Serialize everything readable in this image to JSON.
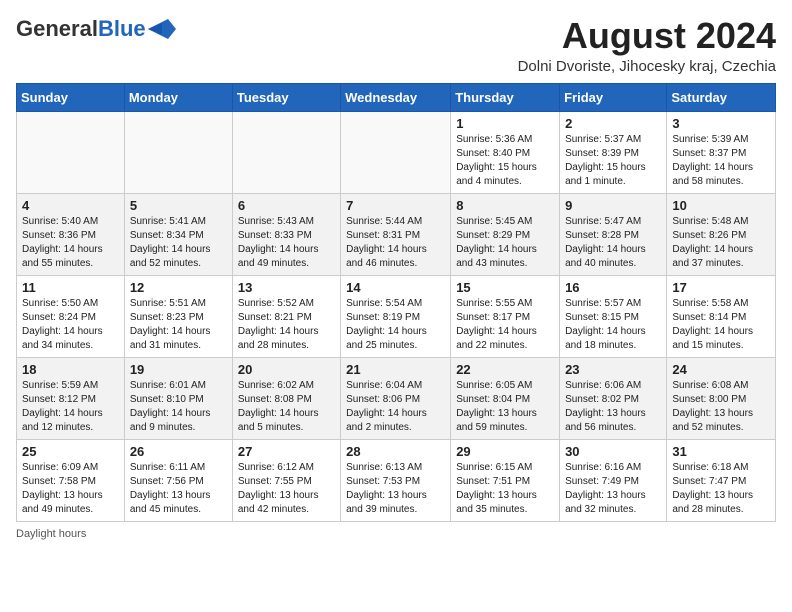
{
  "header": {
    "logo_general": "General",
    "logo_blue": "Blue",
    "month_title": "August 2024",
    "subtitle": "Dolni Dvoriste, Jihocesky kraj, Czechia"
  },
  "weekdays": [
    "Sunday",
    "Monday",
    "Tuesday",
    "Wednesday",
    "Thursday",
    "Friday",
    "Saturday"
  ],
  "weeks": [
    [
      {
        "day": "",
        "info": ""
      },
      {
        "day": "",
        "info": ""
      },
      {
        "day": "",
        "info": ""
      },
      {
        "day": "",
        "info": ""
      },
      {
        "day": "1",
        "info": "Sunrise: 5:36 AM\nSunset: 8:40 PM\nDaylight: 15 hours\nand 4 minutes."
      },
      {
        "day": "2",
        "info": "Sunrise: 5:37 AM\nSunset: 8:39 PM\nDaylight: 15 hours\nand 1 minute."
      },
      {
        "day": "3",
        "info": "Sunrise: 5:39 AM\nSunset: 8:37 PM\nDaylight: 14 hours\nand 58 minutes."
      }
    ],
    [
      {
        "day": "4",
        "info": "Sunrise: 5:40 AM\nSunset: 8:36 PM\nDaylight: 14 hours\nand 55 minutes."
      },
      {
        "day": "5",
        "info": "Sunrise: 5:41 AM\nSunset: 8:34 PM\nDaylight: 14 hours\nand 52 minutes."
      },
      {
        "day": "6",
        "info": "Sunrise: 5:43 AM\nSunset: 8:33 PM\nDaylight: 14 hours\nand 49 minutes."
      },
      {
        "day": "7",
        "info": "Sunrise: 5:44 AM\nSunset: 8:31 PM\nDaylight: 14 hours\nand 46 minutes."
      },
      {
        "day": "8",
        "info": "Sunrise: 5:45 AM\nSunset: 8:29 PM\nDaylight: 14 hours\nand 43 minutes."
      },
      {
        "day": "9",
        "info": "Sunrise: 5:47 AM\nSunset: 8:28 PM\nDaylight: 14 hours\nand 40 minutes."
      },
      {
        "day": "10",
        "info": "Sunrise: 5:48 AM\nSunset: 8:26 PM\nDaylight: 14 hours\nand 37 minutes."
      }
    ],
    [
      {
        "day": "11",
        "info": "Sunrise: 5:50 AM\nSunset: 8:24 PM\nDaylight: 14 hours\nand 34 minutes."
      },
      {
        "day": "12",
        "info": "Sunrise: 5:51 AM\nSunset: 8:23 PM\nDaylight: 14 hours\nand 31 minutes."
      },
      {
        "day": "13",
        "info": "Sunrise: 5:52 AM\nSunset: 8:21 PM\nDaylight: 14 hours\nand 28 minutes."
      },
      {
        "day": "14",
        "info": "Sunrise: 5:54 AM\nSunset: 8:19 PM\nDaylight: 14 hours\nand 25 minutes."
      },
      {
        "day": "15",
        "info": "Sunrise: 5:55 AM\nSunset: 8:17 PM\nDaylight: 14 hours\nand 22 minutes."
      },
      {
        "day": "16",
        "info": "Sunrise: 5:57 AM\nSunset: 8:15 PM\nDaylight: 14 hours\nand 18 minutes."
      },
      {
        "day": "17",
        "info": "Sunrise: 5:58 AM\nSunset: 8:14 PM\nDaylight: 14 hours\nand 15 minutes."
      }
    ],
    [
      {
        "day": "18",
        "info": "Sunrise: 5:59 AM\nSunset: 8:12 PM\nDaylight: 14 hours\nand 12 minutes."
      },
      {
        "day": "19",
        "info": "Sunrise: 6:01 AM\nSunset: 8:10 PM\nDaylight: 14 hours\nand 9 minutes."
      },
      {
        "day": "20",
        "info": "Sunrise: 6:02 AM\nSunset: 8:08 PM\nDaylight: 14 hours\nand 5 minutes."
      },
      {
        "day": "21",
        "info": "Sunrise: 6:04 AM\nSunset: 8:06 PM\nDaylight: 14 hours\nand 2 minutes."
      },
      {
        "day": "22",
        "info": "Sunrise: 6:05 AM\nSunset: 8:04 PM\nDaylight: 13 hours\nand 59 minutes."
      },
      {
        "day": "23",
        "info": "Sunrise: 6:06 AM\nSunset: 8:02 PM\nDaylight: 13 hours\nand 56 minutes."
      },
      {
        "day": "24",
        "info": "Sunrise: 6:08 AM\nSunset: 8:00 PM\nDaylight: 13 hours\nand 52 minutes."
      }
    ],
    [
      {
        "day": "25",
        "info": "Sunrise: 6:09 AM\nSunset: 7:58 PM\nDaylight: 13 hours\nand 49 minutes."
      },
      {
        "day": "26",
        "info": "Sunrise: 6:11 AM\nSunset: 7:56 PM\nDaylight: 13 hours\nand 45 minutes."
      },
      {
        "day": "27",
        "info": "Sunrise: 6:12 AM\nSunset: 7:55 PM\nDaylight: 13 hours\nand 42 minutes."
      },
      {
        "day": "28",
        "info": "Sunrise: 6:13 AM\nSunset: 7:53 PM\nDaylight: 13 hours\nand 39 minutes."
      },
      {
        "day": "29",
        "info": "Sunrise: 6:15 AM\nSunset: 7:51 PM\nDaylight: 13 hours\nand 35 minutes."
      },
      {
        "day": "30",
        "info": "Sunrise: 6:16 AM\nSunset: 7:49 PM\nDaylight: 13 hours\nand 32 minutes."
      },
      {
        "day": "31",
        "info": "Sunrise: 6:18 AM\nSunset: 7:47 PM\nDaylight: 13 hours\nand 28 minutes."
      }
    ]
  ],
  "footer": {
    "daylight_label": "Daylight hours"
  }
}
